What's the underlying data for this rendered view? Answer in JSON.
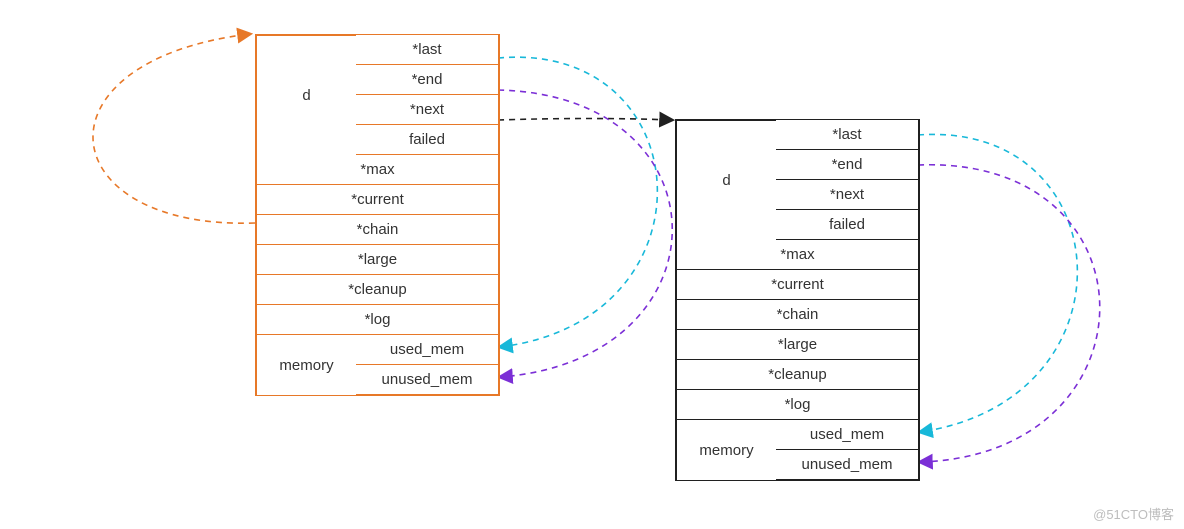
{
  "pool1": {
    "d_label": "d",
    "d": {
      "last": "*last",
      "end": "*end",
      "next": "*next",
      "failed": "failed"
    },
    "fields": {
      "max": "*max",
      "current": "*current",
      "chain": "*chain",
      "large": "*large",
      "cleanup": "*cleanup",
      "log": "*log"
    },
    "memory_label": "memory",
    "memory": {
      "used": "used_mem",
      "unused": "unused_mem"
    },
    "border_color": "#e77828"
  },
  "pool2": {
    "d_label": "d",
    "d": {
      "last": "*last",
      "end": "*end",
      "next": "*next",
      "failed": "failed"
    },
    "fields": {
      "max": "*max",
      "current": "*current",
      "chain": "*chain",
      "large": "*large",
      "cleanup": "*cleanup",
      "log": "*log"
    },
    "memory_label": "memory",
    "memory": {
      "used": "used_mem",
      "unused": "unused_mem"
    },
    "border_color": "#202020"
  },
  "pointers": [
    {
      "name": "p1.current -> pool1.top",
      "color": "#e77828"
    },
    {
      "name": "p1.d.next  -> pool2.top",
      "color": "#202020"
    },
    {
      "name": "p1.d.last  -> pool1.used_mem",
      "color": "#18b8d9"
    },
    {
      "name": "p1.d.end   -> pool1.unused_mem",
      "color": "#7b2fd6"
    },
    {
      "name": "p2.d.last  -> pool2.used_mem",
      "color": "#18b8d9"
    },
    {
      "name": "p2.d.end   -> pool2.unused_mem",
      "color": "#7b2fd6"
    }
  ],
  "colors": {
    "orange": "#e77828",
    "cyan": "#18b8d9",
    "purple": "#7b2fd6",
    "black": "#202020"
  },
  "watermark": "@51CTO博客"
}
